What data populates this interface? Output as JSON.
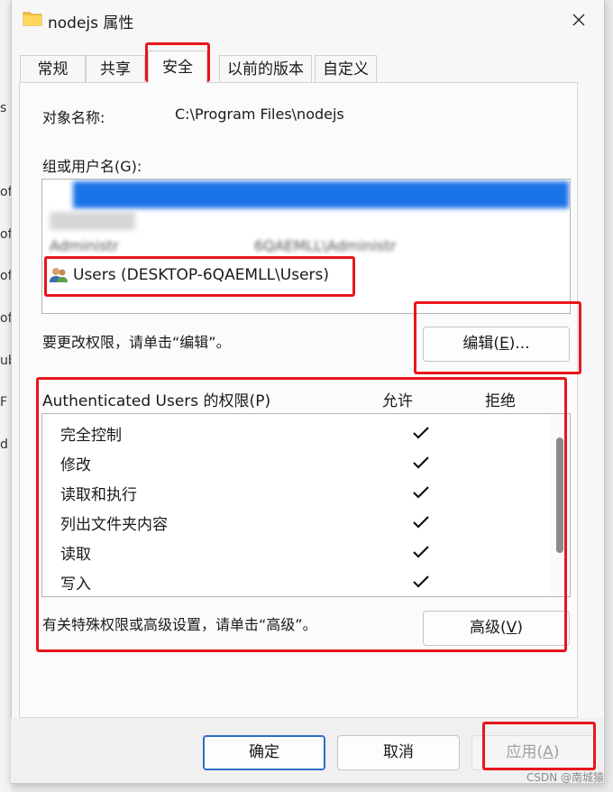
{
  "window": {
    "title": "nodejs 属性",
    "close_icon": "close-icon"
  },
  "background_letters": [
    "s",
    "of",
    "of",
    "of",
    "of",
    "ub",
    "F",
    "d"
  ],
  "tabs": [
    {
      "label": "常规",
      "active": false
    },
    {
      "label": "共享",
      "active": false
    },
    {
      "label": "安全",
      "active": true
    },
    {
      "label": "以前的版本",
      "active": false
    },
    {
      "label": "自定义",
      "active": false
    }
  ],
  "object": {
    "label": "对象名称:",
    "value": "C:\\Program Files\\nodejs"
  },
  "groups": {
    "label": "组或用户名(G):",
    "visible_user": "Users (DESKTOP-6QAEMLL\\Users)",
    "partial_user": "Administr",
    "partial_user_tail": "6QAEMLL\\Administr"
  },
  "edit": {
    "hint": "要更改权限，请单击“编辑”。",
    "button_prefix": "编辑(",
    "button_key": "E",
    "button_suffix": ")..."
  },
  "permissions": {
    "header": "Authenticated Users 的权限(P)",
    "allow_label": "允许",
    "deny_label": "拒绝",
    "rows": [
      {
        "name": "完全控制",
        "allow": true,
        "deny": false
      },
      {
        "name": "修改",
        "allow": true,
        "deny": false
      },
      {
        "name": "读取和执行",
        "allow": true,
        "deny": false
      },
      {
        "name": "列出文件夹内容",
        "allow": true,
        "deny": false
      },
      {
        "name": "读取",
        "allow": true,
        "deny": false
      },
      {
        "name": "写入",
        "allow": true,
        "deny": false
      }
    ]
  },
  "advanced": {
    "hint": "有关特殊权限或高级设置，请单击“高级”。",
    "button_prefix": "高级(",
    "button_key": "V",
    "button_suffix": ")"
  },
  "footer": {
    "ok_label": "确定",
    "cancel_label": "取消",
    "apply_prefix": "应用(",
    "apply_key": "A",
    "apply_suffix": ")"
  },
  "watermark": "CSDN @南城猿",
  "colors": {
    "accent": "#2b6cc4",
    "selection": "#1a73e8",
    "highlight": "#e8161c"
  }
}
